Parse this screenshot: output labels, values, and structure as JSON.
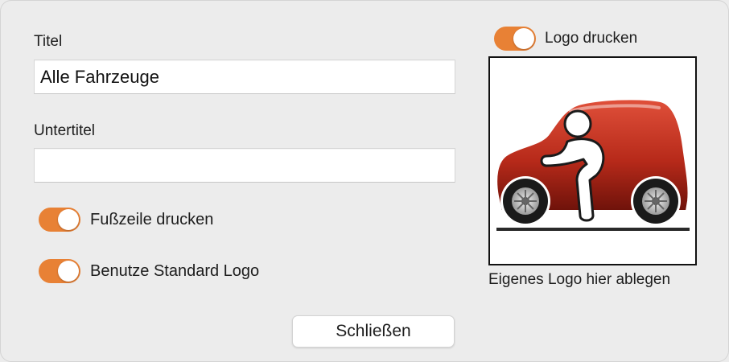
{
  "form": {
    "title_label": "Titel",
    "title_value": "Alle Fahrzeuge",
    "subtitle_label": "Untertitel",
    "subtitle_value": ""
  },
  "toggles": {
    "footer": {
      "label": "Fußzeile drucken",
      "on": true
    },
    "standard_logo": {
      "label": "Benutze Standard Logo",
      "on": true
    },
    "print_logo": {
      "label": "Logo drucken",
      "on": true
    }
  },
  "logo": {
    "drop_hint": "Eigenes Logo hier ablegen",
    "image_icon": "car-with-driver-icon"
  },
  "buttons": {
    "close_label": "Schließen"
  },
  "colors": {
    "toggle_on": "#e88135",
    "car_body": "#c0321f",
    "window_bg": "#ececec"
  }
}
